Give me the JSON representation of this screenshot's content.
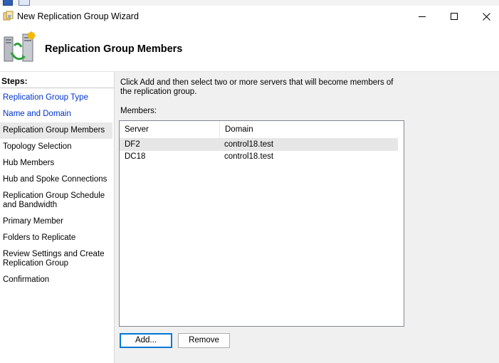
{
  "window": {
    "title": "New Replication Group Wizard",
    "controls": [
      "minimize-icon",
      "maximize-icon",
      "close-icon"
    ]
  },
  "header": {
    "title": "Replication Group Members",
    "icon": "replication-servers-icon"
  },
  "sidebar": {
    "heading": "Steps:",
    "items": [
      {
        "label": "Replication Group Type"
      },
      {
        "label": "Name and Domain"
      },
      {
        "label": "Replication Group Members"
      },
      {
        "label": "Topology Selection"
      },
      {
        "label": "Hub Members"
      },
      {
        "label": "Hub and Spoke Connections"
      },
      {
        "label": "Replication Group Schedule and Bandwidth"
      },
      {
        "label": "Primary Member"
      },
      {
        "label": "Folders to Replicate"
      },
      {
        "label": "Review Settings and Create Replication Group"
      },
      {
        "label": "Confirmation"
      }
    ]
  },
  "main": {
    "instruction": "Click Add and then select two or more servers that will become members of the replication group.",
    "members_label": "Members:",
    "columns": [
      "Server",
      "Domain"
    ],
    "rows": [
      {
        "server": "DF2",
        "domain": "control18.test"
      },
      {
        "server": "DC18",
        "domain": "control18.test"
      }
    ],
    "add_label": "Add...",
    "remove_label": "Remove"
  },
  "colors": {
    "link": "#0033cc",
    "content_bg": "#f0f0f0",
    "selected_row": "#e6e6e6",
    "default_button_border": "#0078d7"
  }
}
